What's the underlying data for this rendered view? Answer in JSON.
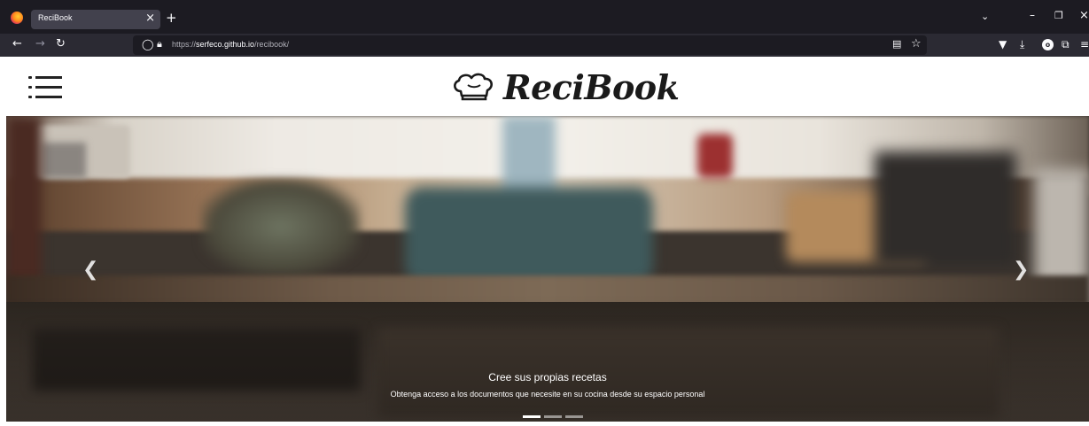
{
  "browser": {
    "tab_title": "ReciBook",
    "tab_close": "×",
    "new_tab": "+",
    "url_prefix": "https://",
    "url_domain": "serfeco.github.io",
    "url_path": "/recibook/",
    "icons": [
      "firefox-logo",
      "back-icon",
      "forward-icon",
      "reload-icon",
      "shield-icon",
      "lock-icon",
      "reader-view-icon",
      "bookmark-star-icon",
      "pocket-icon",
      "download-icon",
      "account-icon",
      "extensions-icon",
      "menu-icon",
      "tabs-list-icon",
      "minimize-icon",
      "maximize-icon",
      "close-icon"
    ]
  },
  "header": {
    "brand": "ReciBook",
    "menu_icon": "hamburger-menu-icon",
    "logo_icon": "chef-hat-icon"
  },
  "carousel": {
    "caption_title": "Cree sus propias recetas",
    "caption_text": "Obtenga acceso a los documentos que necesite en su cocina desde su espacio personal",
    "prev_icon": "chevron-left-icon",
    "next_icon": "chevron-right-icon",
    "slide_count": 3,
    "active_slide": 1
  },
  "colors": {
    "tabbar": "#1c1b22",
    "navbar": "#2b2a33",
    "tab_active": "#42414d",
    "page_bg": "#ffffff"
  }
}
